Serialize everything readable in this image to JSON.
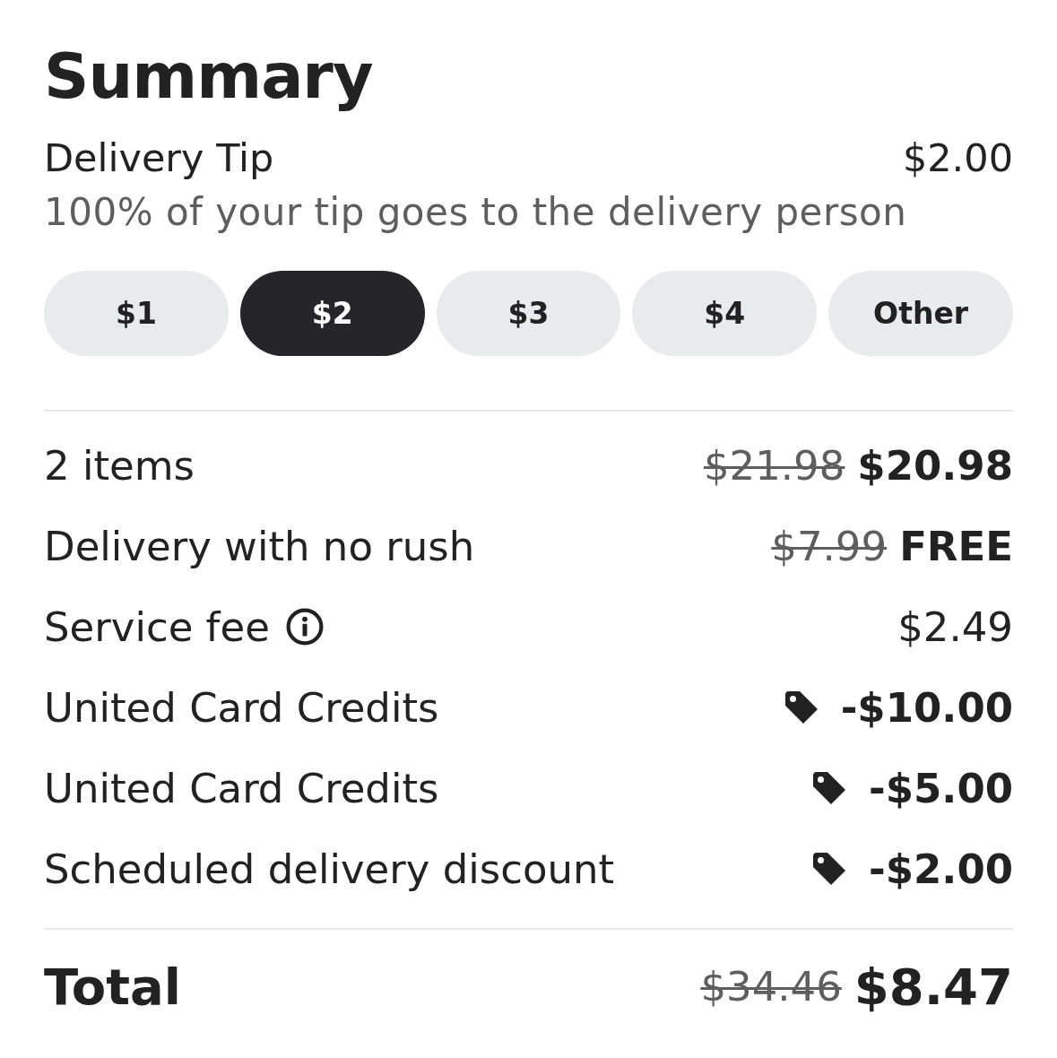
{
  "title": "Summary",
  "tip": {
    "label": "Delivery Tip",
    "amount": "$2.00",
    "note": "100% of your tip goes to the delivery person"
  },
  "tip_options": [
    {
      "label": "$1",
      "selected": false
    },
    {
      "label": "$2",
      "selected": true
    },
    {
      "label": "$3",
      "selected": false
    },
    {
      "label": "$4",
      "selected": false
    },
    {
      "label": "Other",
      "selected": false
    }
  ],
  "line_items": [
    {
      "label": "2 items",
      "info": false,
      "tag": false,
      "original_price": "$21.98",
      "price": "$20.98",
      "emphasized": true
    },
    {
      "label": "Delivery with no rush",
      "info": false,
      "tag": false,
      "original_price": "$7.99",
      "price": "FREE",
      "emphasized": true
    },
    {
      "label": "Service fee",
      "info": true,
      "tag": false,
      "price": "$2.49",
      "emphasized": false
    },
    {
      "label": "United Card Credits",
      "info": false,
      "tag": true,
      "price": "-$10.00",
      "emphasized": true
    },
    {
      "label": "United Card Credits",
      "info": false,
      "tag": true,
      "price": "-$5.00",
      "emphasized": true
    },
    {
      "label": "Scheduled delivery discount",
      "info": false,
      "tag": true,
      "price": "-$2.00",
      "emphasized": true
    }
  ],
  "total": {
    "label": "Total",
    "original_price": "$34.46",
    "price": "$8.47"
  }
}
